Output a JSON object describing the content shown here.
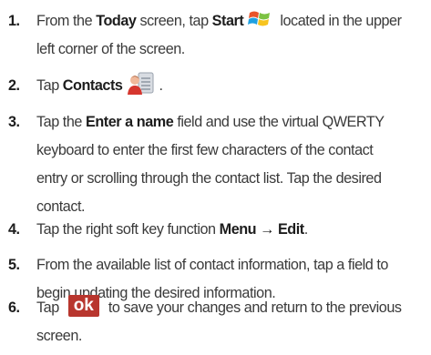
{
  "steps": [
    {
      "number": "1.",
      "l1_pre": "From the ",
      "l1_b1": "Today",
      "l1_mid": " screen, tap ",
      "l1_b2": "Start",
      "l1_post": " located in the upper",
      "l2": "left corner of the screen.",
      "icon": "windows-start-flag-icon"
    },
    {
      "number": "2.",
      "pre": "Tap ",
      "bold": "Contacts",
      "post": ".",
      "icon": "contacts-icon"
    },
    {
      "number": "3.",
      "l1_pre": "Tap the ",
      "l1_b": "Enter a name",
      "l1_post": " field and use the virtual QWERTY",
      "l2": "keyboard to enter the first few characters of the contact",
      "l3": "entry or scrolling through the contact list. Tap the desired",
      "l4": "contact."
    },
    {
      "number": "4.",
      "pre": "Tap the right soft key function ",
      "bold": "Menu → Edit",
      "post": "."
    },
    {
      "number": "5.",
      "l1": "From the available list of contact information, tap a field to",
      "l2": "begin updating the desired information."
    },
    {
      "number": "6.",
      "pre": "Tap ",
      "ok_label": "ok",
      "post": " to save your changes and return to the previous",
      "l2": "screen."
    }
  ],
  "colors": {
    "text": "#3a3a3a",
    "bold": "#1d1d1d",
    "ok_button": "#b8362e"
  }
}
